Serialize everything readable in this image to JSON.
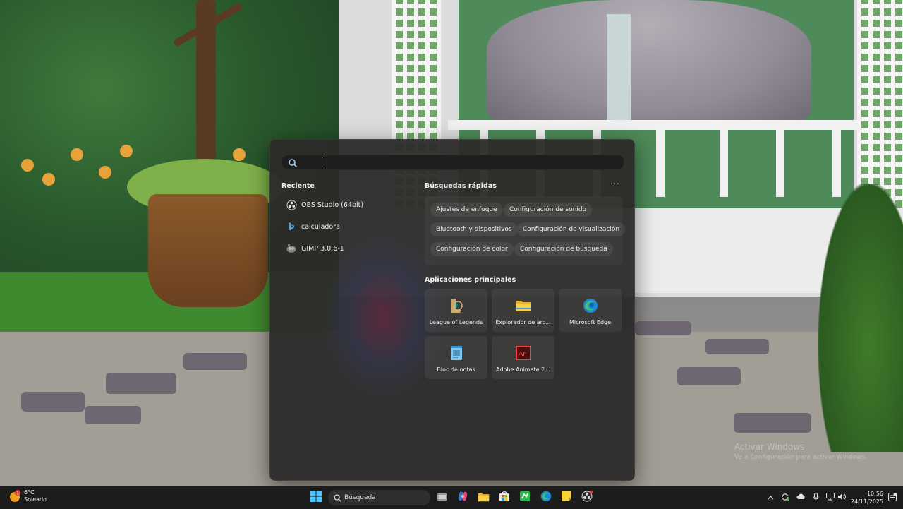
{
  "search": {
    "value": "",
    "placeholder": ""
  },
  "recent": {
    "title": "Reciente",
    "items": [
      {
        "label": "OBS Studio (64bit)",
        "icon": "obs-icon"
      },
      {
        "label": "calculadora",
        "icon": "bing-icon"
      },
      {
        "label": "GIMP 3.0.6-1",
        "icon": "gimp-icon"
      }
    ]
  },
  "quick_searches": {
    "title": "Búsquedas rápidas",
    "more": "···",
    "chips": [
      "Ajustes de enfoque",
      "Configuración de sonido",
      "Bluetooth y dispositivos",
      "Configuración de visualización",
      "Configuración de color",
      "Configuración de búsqueda"
    ]
  },
  "top_apps": {
    "title": "Aplicaciones principales",
    "apps": [
      {
        "label": "League of Legends",
        "icon": "league-of-legends-icon"
      },
      {
        "label": "Explorador de arc...",
        "icon": "file-explorer-icon"
      },
      {
        "label": "Microsoft Edge",
        "icon": "edge-icon"
      },
      {
        "label": "Bloc de notas",
        "icon": "notepad-icon"
      },
      {
        "label": "Adobe Animate 2...",
        "icon": "adobe-animate-icon"
      }
    ]
  },
  "watermark": {
    "line1": "Activar Windows",
    "line2": "Ve a Configuración para activar Windows."
  },
  "taskbar": {
    "weather": {
      "temp": "6°C",
      "condition": "Soleado",
      "badge": "1"
    },
    "search_label": "Búsqueda",
    "clock": {
      "time": "10:56",
      "date": "24/11/2025"
    }
  },
  "colors": {
    "accent": "#4cc2ff",
    "panel_bg": "#2c2a28",
    "taskbar_bg": "#1c1c1c"
  }
}
